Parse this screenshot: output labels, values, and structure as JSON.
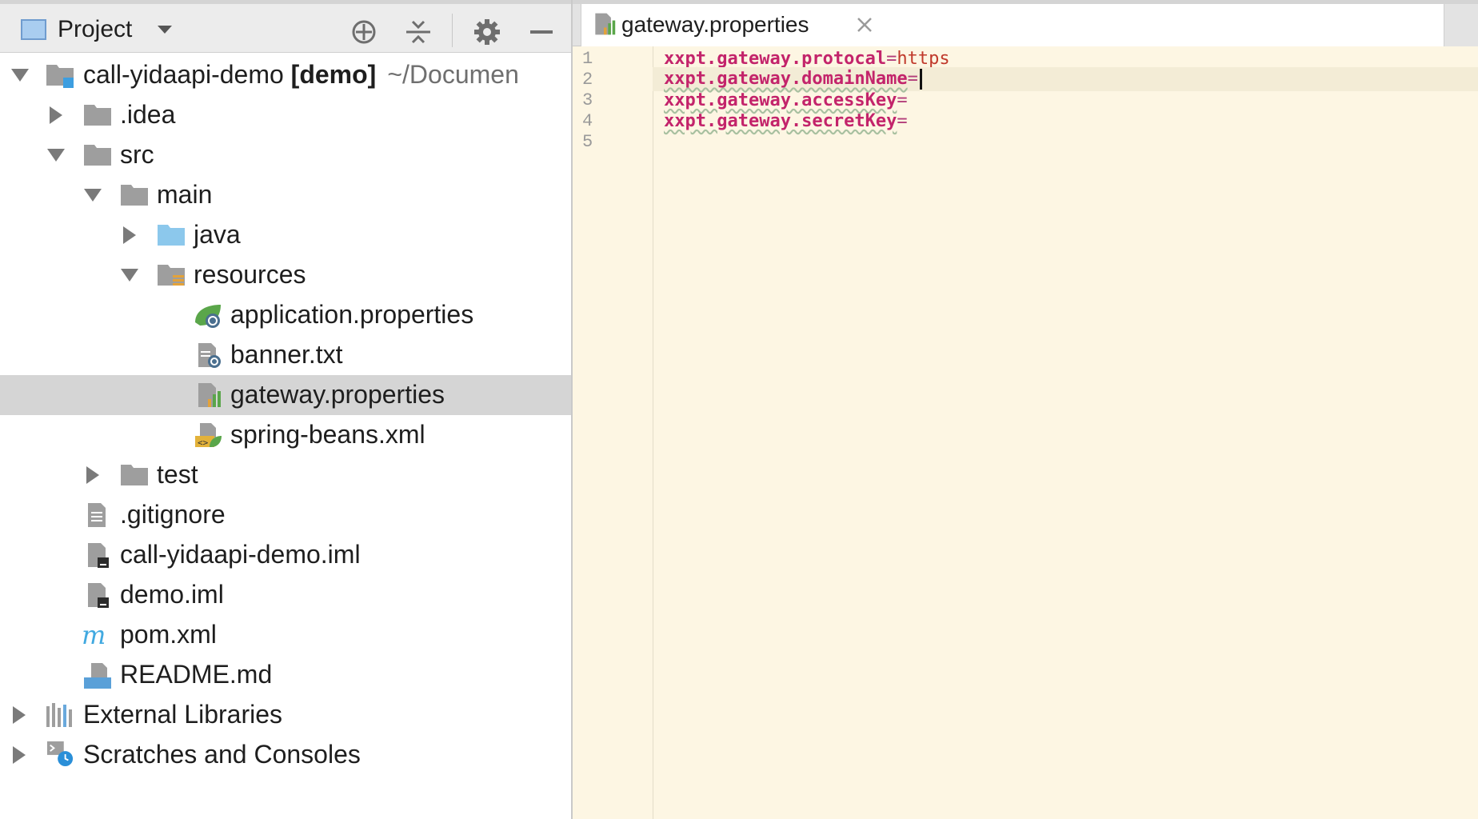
{
  "toolbar": {
    "view_label": "Project",
    "icons": [
      "locate-icon",
      "collapse-all-icon",
      "gear-icon",
      "minimize-icon"
    ]
  },
  "tree": {
    "root_name": "call-yidaapi-demo",
    "root_module": "[demo]",
    "root_path": "~/Documen",
    "items": [
      {
        "label": ".idea"
      },
      {
        "label": "src"
      },
      {
        "label": "main"
      },
      {
        "label": "java"
      },
      {
        "label": "resources"
      },
      {
        "label": "application.properties"
      },
      {
        "label": "banner.txt"
      },
      {
        "label": "gateway.properties"
      },
      {
        "label": "spring-beans.xml"
      },
      {
        "label": "test"
      },
      {
        "label": ".gitignore"
      },
      {
        "label": "call-yidaapi-demo.iml"
      },
      {
        "label": "demo.iml"
      },
      {
        "label": "pom.xml"
      },
      {
        "label": "README.md"
      },
      {
        "label": "External Libraries"
      },
      {
        "label": "Scratches and Consoles"
      }
    ]
  },
  "editor": {
    "tab_label": "gateway.properties",
    "line_numbers": [
      "1",
      "2",
      "3",
      "4",
      "5"
    ],
    "lines": [
      {
        "key": "xxpt.gateway.protocal",
        "eq": "=",
        "value": "https"
      },
      {
        "key": "xxpt.gateway.domainName",
        "eq": "=",
        "value": ""
      },
      {
        "key": "xxpt.gateway.accessKey",
        "eq": "=",
        "value": ""
      },
      {
        "key": "xxpt.gateway.secretKey",
        "eq": "=",
        "value": ""
      }
    ]
  },
  "colors": {
    "editor_bg": "#fdf6e3",
    "key": "#c3246b",
    "value": "#c0392b",
    "selection": "#d5d5d5"
  }
}
